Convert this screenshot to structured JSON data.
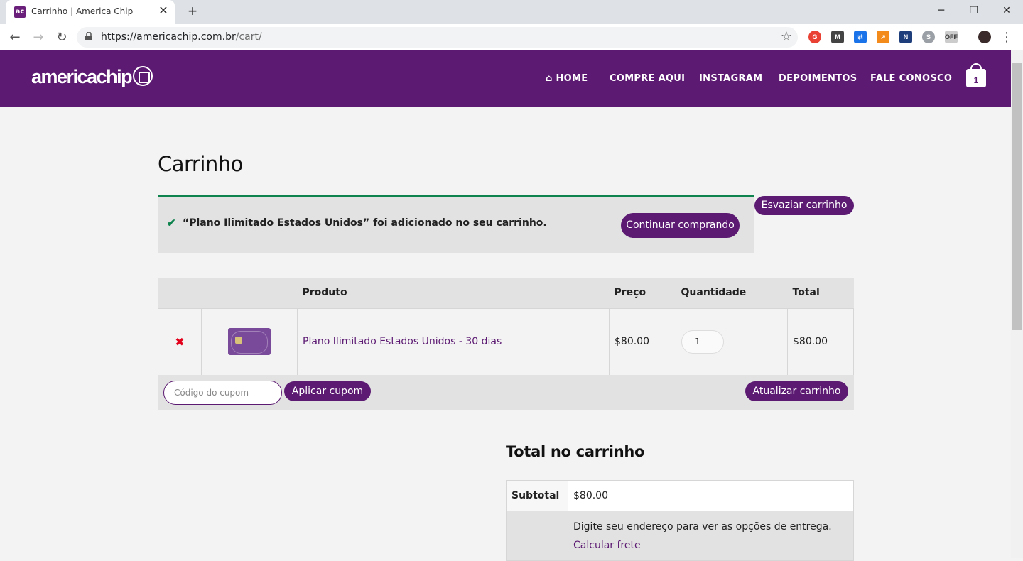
{
  "browser": {
    "tab_title": "Carrinho | America Chip",
    "tab_favicon_text": "ac",
    "url_host": "https://americachip.com.br",
    "url_path": "/cart/"
  },
  "header": {
    "logo_text": "americachip",
    "nav": [
      {
        "label": "HOME",
        "icon": "home-icon"
      },
      {
        "label": "COMPRE AQUI"
      },
      {
        "label": "INSTAGRAM"
      },
      {
        "label": "DEPOIMENTOS"
      },
      {
        "label": "FALE CONOSCO"
      }
    ],
    "cart_count": "1"
  },
  "page": {
    "title": "Carrinho",
    "notice": "“Plano Ilimitado Estados Unidos” foi adicionado no seu carrinho.",
    "continue_label": "Continuar comprando",
    "empty_cart_label": "Esvaziar carrinho"
  },
  "cart": {
    "headers": [
      "",
      "",
      "Produto",
      "Preço",
      "Quantidade",
      "Total"
    ],
    "items": [
      {
        "product": "Plano Ilimitado Estados Unidos - 30 dias",
        "price": "$80.00",
        "quantity": "1",
        "total": "$80.00"
      }
    ],
    "coupon_placeholder": "Código do cupom",
    "apply_coupon_label": "Aplicar cupom",
    "update_cart_label": "Atualizar carrinho"
  },
  "totals": {
    "title": "Total no carrinho",
    "subtotal_label": "Subtotal",
    "subtotal_value": "$80.00",
    "shipping_note": "Digite seu endereço para ver as opções de entrega.",
    "calc_shipping_label": "Calcular frete"
  },
  "colors": {
    "brand_purple": "#5c1a72",
    "success_green": "#0f834d",
    "remove_red": "#e2001a"
  }
}
